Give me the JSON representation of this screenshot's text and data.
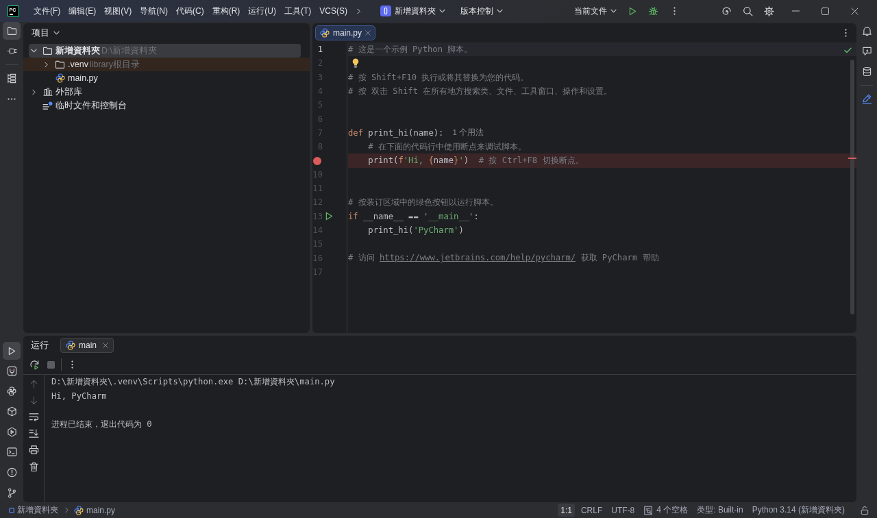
{
  "title_bar": {
    "logo": "PC",
    "menus": [
      "文件(F)",
      "编辑(E)",
      "视图(V)",
      "导航(N)",
      "代码(C)",
      "重构(R)",
      "运行(U)",
      "工具(T)",
      "VCS(S)"
    ],
    "project_widget": "新增資料夾",
    "vcs_widget": "版本控制",
    "run_config": "当前文件"
  },
  "left_toolbar": {
    "top": [
      {
        "kind": "project",
        "selected": true
      },
      {
        "kind": "plugins",
        "selected": false
      },
      {
        "kind": "structure",
        "selected": false
      },
      {
        "kind": "more",
        "selected": false
      }
    ],
    "bottom": [
      {
        "kind": "run",
        "selected": true
      },
      {
        "kind": "tools",
        "selected": false
      },
      {
        "kind": "python_console",
        "selected": false
      },
      {
        "kind": "packages",
        "selected": false
      },
      {
        "kind": "services",
        "selected": false
      },
      {
        "kind": "terminal",
        "selected": false
      },
      {
        "kind": "problems",
        "selected": false
      },
      {
        "kind": "vcs",
        "selected": false
      }
    ]
  },
  "project_panel": {
    "title": "项目",
    "tree": [
      {
        "label": "新增資料夾",
        "note": "D:\\新增資料夾",
        "kind": "module",
        "expanded": true,
        "selected": true,
        "library_root": false,
        "children": [
          {
            "label": ".venv",
            "note": "library根目录",
            "kind": "folder",
            "expanded": false,
            "selected": false,
            "library_root": true
          },
          {
            "label": "main.py",
            "kind": "python_file",
            "selected": false,
            "library_root": false
          }
        ]
      },
      {
        "label": "外部库",
        "kind": "library",
        "expanded": false,
        "selected": false,
        "library_root": false
      },
      {
        "label": "临时文件和控制台",
        "kind": "scratches",
        "selected": false,
        "library_root": false
      }
    ]
  },
  "editor": {
    "tabs": [
      {
        "label": "main.py",
        "selected": true
      }
    ],
    "lines": [
      {
        "number": "1",
        "current": true,
        "breakpoint": false,
        "run_button": false,
        "intention_bulb": false,
        "tokens": [
          {
            "kind": "comment",
            "text": "# 这是一个示例 Python 脚本。"
          }
        ]
      },
      {
        "number": "2",
        "current": false,
        "breakpoint": false,
        "run_button": false,
        "intention_bulb": true
      },
      {
        "number": "3",
        "current": false,
        "breakpoint": false,
        "run_button": false,
        "intention_bulb": false,
        "tokens": [
          {
            "kind": "comment",
            "text": "# 按 Shift+F10 执行或将其替换为您的代码。"
          }
        ]
      },
      {
        "number": "4",
        "current": false,
        "breakpoint": false,
        "run_button": false,
        "intention_bulb": false,
        "tokens": [
          {
            "kind": "comment",
            "text": "# 按 双击 Shift 在所有地方搜索类、文件、工具窗口、操作和设置。"
          }
        ]
      },
      {
        "number": "5",
        "current": false,
        "breakpoint": false,
        "run_button": false,
        "intention_bulb": false
      },
      {
        "number": "6",
        "current": false,
        "breakpoint": false,
        "run_button": false,
        "intention_bulb": false
      },
      {
        "number": "7",
        "current": false,
        "breakpoint": false,
        "run_button": false,
        "intention_bulb": false,
        "tokens": [
          {
            "kind": "keyword",
            "text": "def"
          },
          {
            "kind": "plain",
            "text": " print_hi(name):"
          }
        ],
        "hint": "1 个用法"
      },
      {
        "number": "8",
        "current": false,
        "breakpoint": false,
        "run_button": false,
        "intention_bulb": false,
        "tokens": [
          {
            "kind": "comment",
            "text": "    # 在下面的代码行中使用断点来调试脚本。"
          }
        ]
      },
      {
        "current": false,
        "breakpoint": true,
        "run_button": false,
        "intention_bulb": false,
        "tokens": [
          {
            "kind": "plain",
            "text": "    print("
          },
          {
            "kind": "keyword",
            "text": "f"
          },
          {
            "kind": "string",
            "text": "'Hi, "
          },
          {
            "kind": "brace",
            "text": "{"
          },
          {
            "kind": "plain",
            "text": "name"
          },
          {
            "kind": "brace",
            "text": "}"
          },
          {
            "kind": "string",
            "text": "'"
          },
          {
            "kind": "plain",
            "text": ")  "
          },
          {
            "kind": "comment",
            "text": "# 按 Ctrl+F8 切换断点。"
          }
        ]
      },
      {
        "number": "10",
        "current": false,
        "breakpoint": false,
        "run_button": false,
        "intention_bulb": false
      },
      {
        "number": "11",
        "current": false,
        "breakpoint": false,
        "run_button": false,
        "intention_bulb": false
      },
      {
        "number": "12",
        "current": false,
        "breakpoint": false,
        "run_button": false,
        "intention_bulb": false,
        "tokens": [
          {
            "kind": "comment",
            "text": "# 按装订区域中的绿色按钮以运行脚本。"
          }
        ]
      },
      {
        "number": "13",
        "current": false,
        "breakpoint": false,
        "run_button": true,
        "intention_bulb": false,
        "tokens": [
          {
            "kind": "keyword",
            "text": "if"
          },
          {
            "kind": "plain",
            "text": " __name__ == "
          },
          {
            "kind": "string",
            "text": "'__main__'"
          },
          {
            "kind": "plain",
            "text": ":"
          }
        ]
      },
      {
        "number": "14",
        "current": false,
        "breakpoint": false,
        "run_button": false,
        "intention_bulb": false,
        "tokens": [
          {
            "kind": "plain",
            "text": "    print_hi("
          },
          {
            "kind": "string",
            "text": "'PyCharm'"
          },
          {
            "kind": "plain",
            "text": ")"
          }
        ]
      },
      {
        "number": "15",
        "current": false,
        "breakpoint": false,
        "run_button": false,
        "intention_bulb": false
      },
      {
        "number": "16",
        "current": false,
        "breakpoint": false,
        "run_button": false,
        "intention_bulb": false,
        "tokens": [
          {
            "kind": "comment",
            "text": "# 访问 "
          },
          {
            "kind": "link",
            "text": "https://www.jetbrains.com/help/pycharm/"
          },
          {
            "kind": "comment",
            "text": " 获取 PyCharm 帮助"
          }
        ]
      },
      {
        "number": "17",
        "current": false,
        "breakpoint": false,
        "run_button": false,
        "intention_bulb": false
      }
    ]
  },
  "run_panel": {
    "title": "运行",
    "tabs": [
      {
        "label": "main",
        "selected": true
      }
    ],
    "toolbar": [
      {
        "kind": "rerun",
        "disabled": false
      },
      {
        "kind": "stop",
        "disabled": true
      }
    ],
    "side_tools": [
      {
        "kind": "up",
        "disabled": true
      },
      {
        "kind": "down",
        "disabled": true
      },
      {
        "kind": "soft_wrap",
        "disabled": false
      },
      {
        "kind": "scroll_end",
        "disabled": false
      },
      {
        "kind": "print",
        "disabled": false
      },
      {
        "kind": "clear",
        "disabled": false
      }
    ],
    "console": [
      {
        "kind": "command",
        "text": "D:\\新增資料夾\\.venv\\Scripts\\python.exe D:\\新增資料夾\\main.py"
      },
      {
        "kind": "output",
        "text": "Hi, PyCharm"
      },
      {
        "kind": "exit",
        "text": "进程已结束，退出代码为 0"
      }
    ]
  },
  "status_bar": {
    "breadcrumbs": [
      {
        "label": "新增資料夾",
        "kind": "module"
      },
      {
        "label": "main.py",
        "kind": "python_file"
      }
    ],
    "items": [
      {
        "label": "1:1",
        "kind": "position",
        "hovered": true
      },
      {
        "label": "CRLF",
        "kind": "line_separator",
        "hovered": false
      },
      {
        "label": "UTF-8",
        "kind": "encoding",
        "hovered": false
      },
      {
        "label": "4 个空格",
        "kind": "indent",
        "hovered": false
      },
      {
        "label": "类型: Built-in",
        "kind": "file_type",
        "hovered": false
      },
      {
        "label": "Python 3.14 (新增資料夾)",
        "kind": "interpreter",
        "hovered": false
      }
    ]
  }
}
